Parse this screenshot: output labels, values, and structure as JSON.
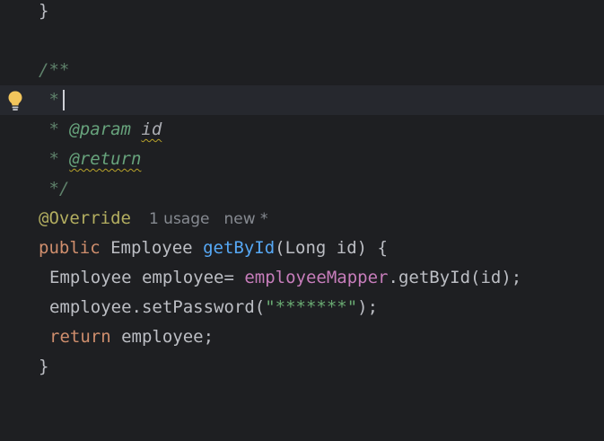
{
  "code_lines": {
    "l1": {
      "brace": "}"
    },
    "l2": {},
    "l3": {
      "doc_open": "/**"
    },
    "l4": {
      "star": " *"
    },
    "l5": {
      "star": " * ",
      "tag": "@param",
      "space": " ",
      "param": "id"
    },
    "l6": {
      "star": " * ",
      "tag": "@return"
    },
    "l7": {
      "close": " */"
    },
    "l8": {
      "annotation": "@Override",
      "usage_hint": "1 usage",
      "new_hint": "new *"
    },
    "l9": {
      "kw": "public",
      "sp1": " ",
      "type": "Employee",
      "sp2": " ",
      "method": "getById",
      "rest": "(Long id) {"
    },
    "l10": {
      "pre": "Employee employee= ",
      "field": "employeeMapper",
      "post": ".getById(id);"
    },
    "l11": {
      "pre": "employee.setPassword(",
      "str": "\"*******\"",
      "post": ");"
    },
    "l12": {
      "kw": "return",
      "post": " employee;"
    },
    "l13": {
      "brace": "}"
    }
  },
  "colors": {
    "background": "#1e1f22",
    "current_line": "#26282e",
    "doc_comment": "#5f826b",
    "keyword": "#cf8e6d",
    "annotation": "#b3ae60",
    "method": "#56a8f5",
    "field": "#c77dbb",
    "string": "#6aab73",
    "hint": "#868a91",
    "bulb": "#f2c55c"
  },
  "icons": {
    "gutter": "lightbulb-icon"
  }
}
